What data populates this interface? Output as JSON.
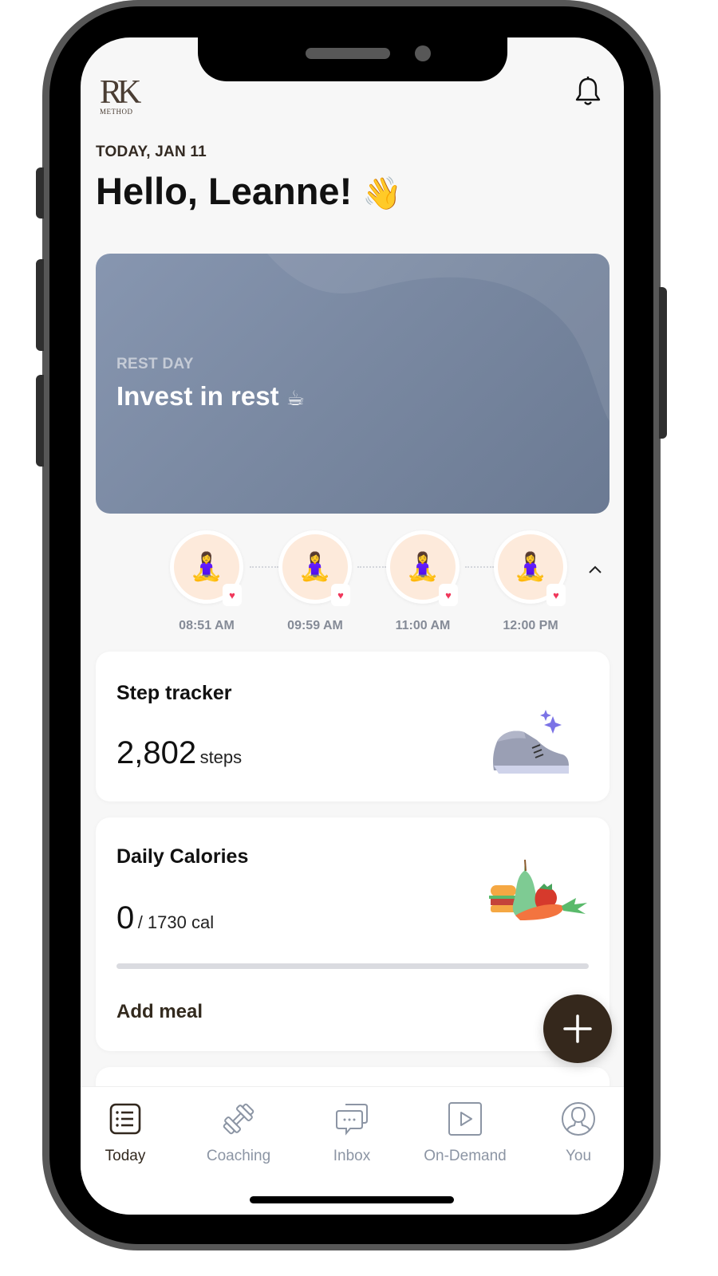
{
  "app": {
    "brand": {
      "logo_mark": "RK",
      "logo_sub": "METHOD"
    },
    "colors": {
      "brand_dark": "#35281c",
      "rest_card": "#7a89a2",
      "inactive_tab": "#8c95a4",
      "heart": "#f0375b",
      "timeline_bg": "#fdeadb"
    }
  },
  "header": {
    "notification_icon": "bell-icon",
    "date_label": "TODAY, JAN 11",
    "greeting": "Hello, Leanne!",
    "greeting_emoji": "👋"
  },
  "rest_card": {
    "eyebrow": "REST DAY",
    "title": "Invest in rest",
    "emoji": "☕"
  },
  "timeline": {
    "items": [
      {
        "emoji": "🧘‍♀️",
        "badge_icon": "heart-icon",
        "time": "08:51 AM"
      },
      {
        "emoji": "🧘‍♀️",
        "badge_icon": "heart-icon",
        "time": "09:59 AM"
      },
      {
        "emoji": "🧘‍♀️",
        "badge_icon": "heart-icon",
        "time": "11:00 AM"
      },
      {
        "emoji": "🧘‍♀️",
        "badge_icon": "heart-icon",
        "time": "12:00 PM"
      }
    ],
    "collapse_icon": "chevron-up-icon"
  },
  "step_tracker": {
    "title": "Step tracker",
    "value": "2,802",
    "unit": "steps",
    "icon": "sneaker-icon"
  },
  "daily_calories": {
    "title": "Daily Calories",
    "value": "0",
    "goal": "/ 1730 cal",
    "progress_fraction": 0,
    "icon": "food-icon",
    "action_label": "Add meal"
  },
  "fab": {
    "icon": "plus-icon"
  },
  "tabbar": {
    "tabs": [
      {
        "label": "Today",
        "icon": "list-icon",
        "active": true
      },
      {
        "label": "Coaching",
        "icon": "dumbbell-icon",
        "active": false
      },
      {
        "label": "Inbox",
        "icon": "chat-icon",
        "active": false
      },
      {
        "label": "On-Demand",
        "icon": "play-icon",
        "active": false
      },
      {
        "label": "You",
        "icon": "profile-icon",
        "active": false
      }
    ]
  }
}
